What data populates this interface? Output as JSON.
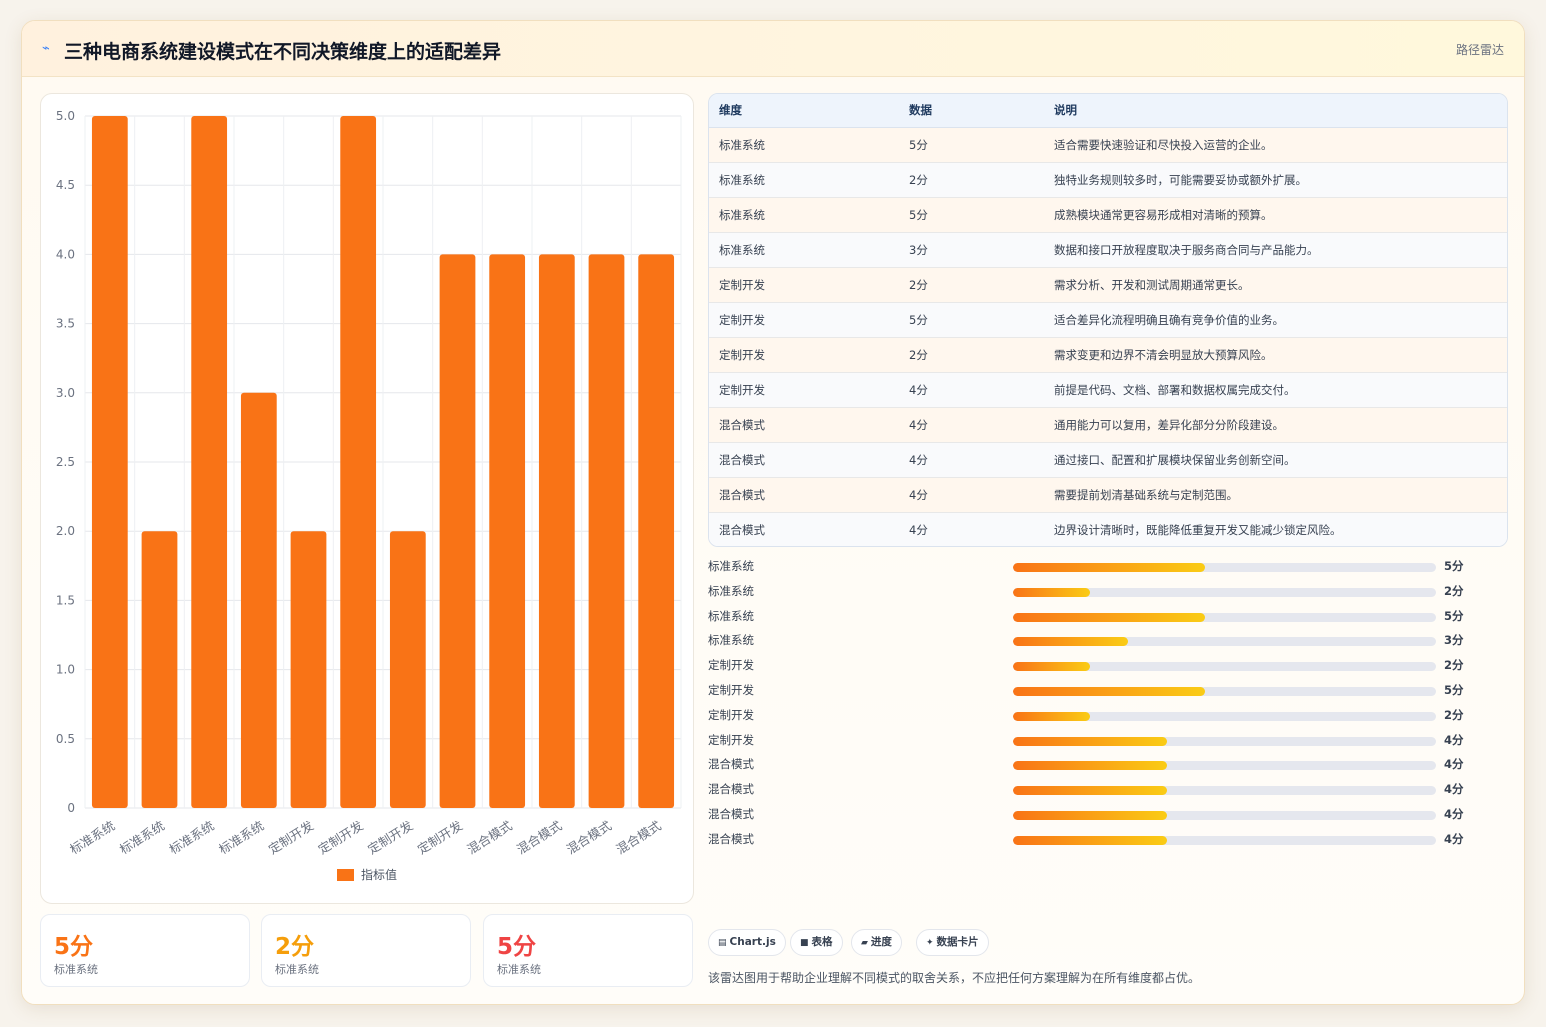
{
  "header": {
    "icon": "pulse-icon",
    "title": "三种电商系统建设模式在不同决策维度上的适配差异",
    "tag": "路径雷达"
  },
  "chart_data": {
    "type": "bar",
    "categories": [
      "标准系统",
      "标准系统",
      "标准系统",
      "标准系统",
      "定制开发",
      "定制开发",
      "定制开发",
      "定制开发",
      "混合模式",
      "混合模式",
      "混合模式",
      "混合模式"
    ],
    "series": [
      {
        "name": "指标值",
        "values": [
          5,
          2,
          5,
          3,
          2,
          5,
          2,
          4,
          4,
          4,
          4,
          4
        ],
        "color": "#f97316"
      }
    ],
    "ylim": [
      0,
      5
    ],
    "yticks": [
      "0",
      "0.5",
      "1.0",
      "1.5",
      "2.0",
      "2.5",
      "3.0",
      "3.5",
      "4.0",
      "4.5",
      "5.0"
    ],
    "grid": true,
    "legend": "bottom"
  },
  "stats": [
    {
      "value": "5分",
      "label": "标准系统",
      "color": "#f97316"
    },
    {
      "value": "2分",
      "label": "标准系统",
      "color": "#f59e0b"
    },
    {
      "value": "5分",
      "label": "标准系统",
      "color": "#ef4444"
    }
  ],
  "table": {
    "headers": [
      "维度",
      "数据",
      "说明"
    ],
    "rows": [
      [
        "标准系统",
        "5分",
        "适合需要快速验证和尽快投入运营的企业。"
      ],
      [
        "标准系统",
        "2分",
        "独特业务规则较多时，可能需要妥协或额外扩展。"
      ],
      [
        "标准系统",
        "5分",
        "成熟模块通常更容易形成相对清晰的预算。"
      ],
      [
        "标准系统",
        "3分",
        "数据和接口开放程度取决于服务商合同与产品能力。"
      ],
      [
        "定制开发",
        "2分",
        "需求分析、开发和测试周期通常更长。"
      ],
      [
        "定制开发",
        "5分",
        "适合差异化流程明确且确有竞争价值的业务。"
      ],
      [
        "定制开发",
        "2分",
        "需求变更和边界不清会明显放大预算风险。"
      ],
      [
        "定制开发",
        "4分",
        "前提是代码、文档、部署和数据权属完成交付。"
      ],
      [
        "混合模式",
        "4分",
        "通用能力可以复用，差异化部分分阶段建设。"
      ],
      [
        "混合模式",
        "4分",
        "通过接口、配置和扩展模块保留业务创新空间。"
      ],
      [
        "混合模式",
        "4分",
        "需要提前划清基础系统与定制范围。"
      ],
      [
        "混合模式",
        "4分",
        "边界设计清晰时，既能降低重复开发又能减少锁定风险。"
      ]
    ]
  },
  "progress": {
    "max": 11,
    "items": [
      {
        "label": "标准系统",
        "value": 5,
        "text": "5分"
      },
      {
        "label": "标准系统",
        "value": 2,
        "text": "2分"
      },
      {
        "label": "标准系统",
        "value": 5,
        "text": "5分"
      },
      {
        "label": "标准系统",
        "value": 3,
        "text": "3分"
      },
      {
        "label": "定制开发",
        "value": 2,
        "text": "2分"
      },
      {
        "label": "定制开发",
        "value": 5,
        "text": "5分"
      },
      {
        "label": "定制开发",
        "value": 2,
        "text": "2分"
      },
      {
        "label": "定制开发",
        "value": 4,
        "text": "4分"
      },
      {
        "label": "混合模式",
        "value": 4,
        "text": "4分"
      },
      {
        "label": "混合模式",
        "value": 4,
        "text": "4分"
      },
      {
        "label": "混合模式",
        "value": 4,
        "text": "4分"
      },
      {
        "label": "混合模式",
        "value": 4,
        "text": "4分"
      }
    ]
  },
  "chips": [
    {
      "icon": "chart-icon",
      "glyph": "▤",
      "label": "Chart.js"
    },
    {
      "icon": "table-icon",
      "glyph": "■",
      "label": "表格"
    },
    {
      "icon": "progress-icon",
      "glyph": "▰",
      "label": "进度"
    },
    {
      "icon": "sparkle-icon",
      "glyph": "✦",
      "label": "数据卡片"
    }
  ],
  "note": "该雷达图用于帮助企业理解不同模式的取舍关系，不应把任何方案理解为在所有维度都占优。"
}
